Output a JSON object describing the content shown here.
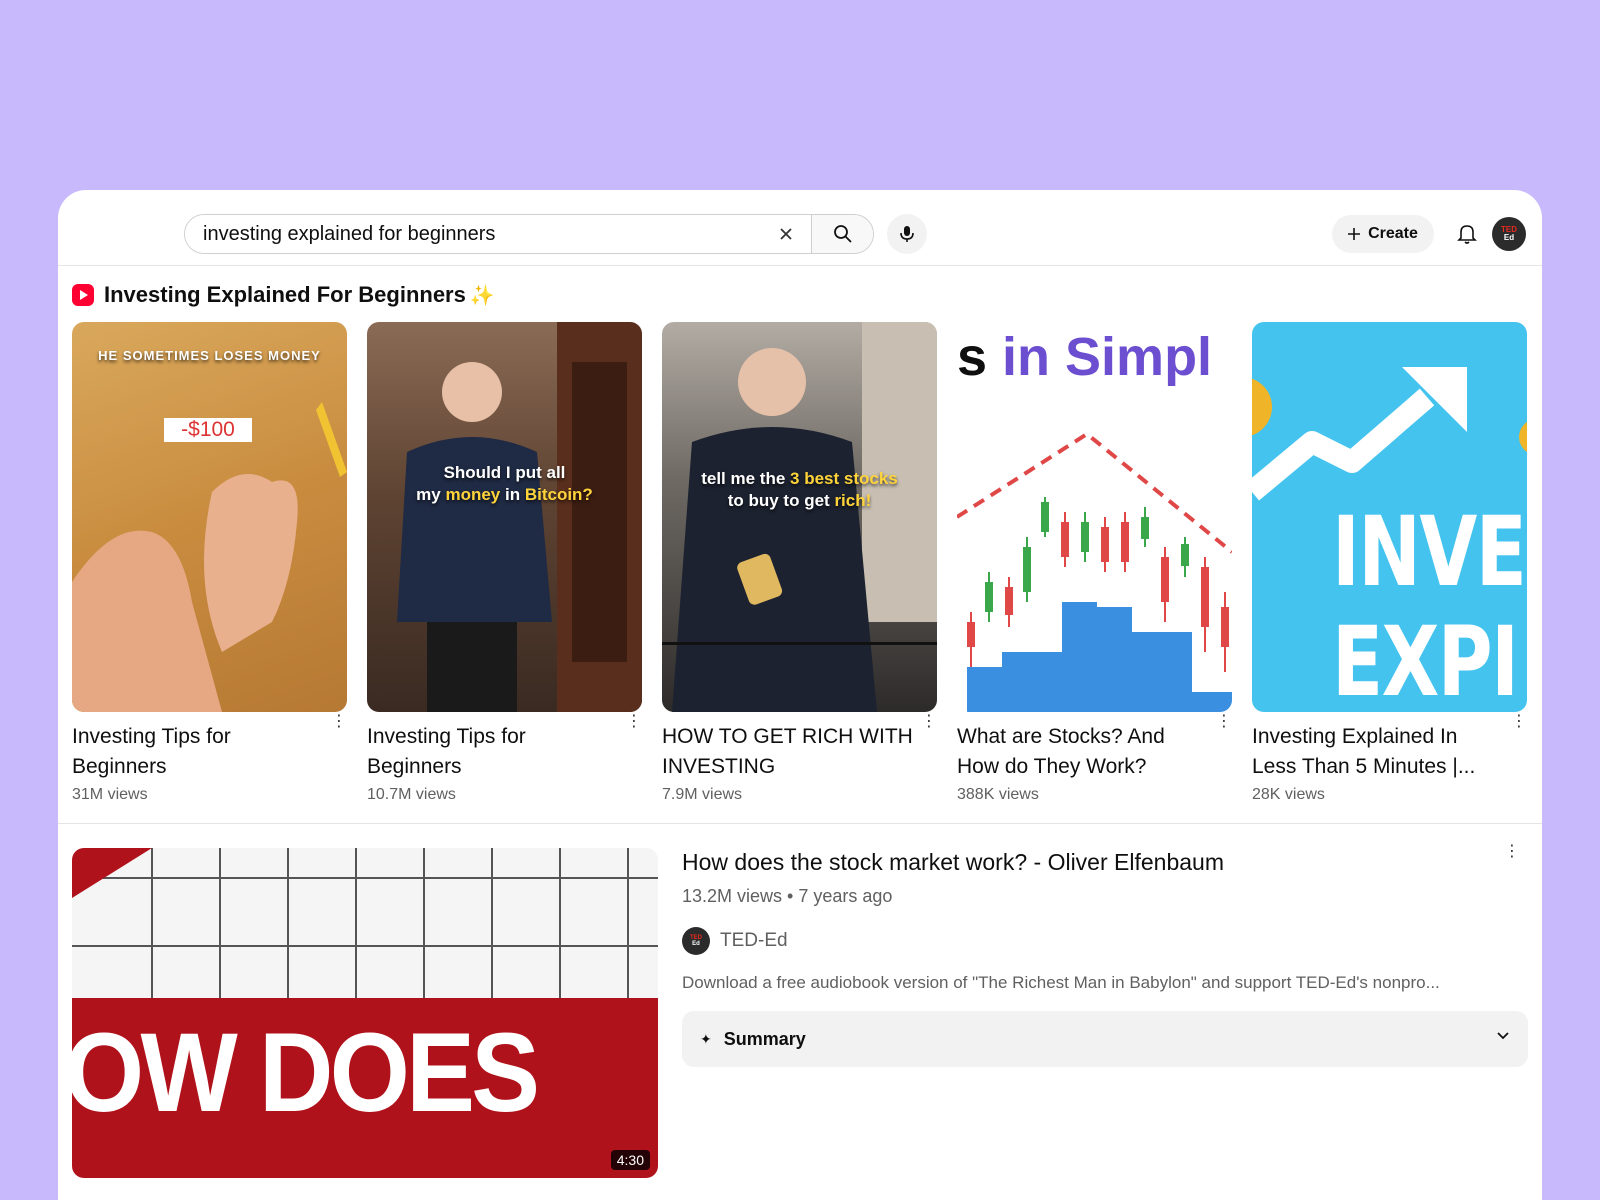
{
  "search": {
    "value": "investing explained for beginners",
    "clear_icon": "close-icon",
    "search_icon": "search-icon"
  },
  "header": {
    "create_label": "Create",
    "avatar_text_top": "TED",
    "avatar_text_bottom": "Ed"
  },
  "shelf": {
    "title": "Investing Explained For Beginners",
    "sparkle": "✨",
    "items": [
      {
        "title": "Investing Tips for Beginners",
        "views": "31M views",
        "thumb_caption": "HE SOMETIMES LOSES MONEY",
        "thumb_label": "-$100"
      },
      {
        "title": "Investing Tips for Beginners",
        "views": "10.7M views",
        "thumb_caption_1": "Should I put all",
        "thumb_caption_2a": "my ",
        "thumb_caption_2b": "money",
        "thumb_caption_2c": " in ",
        "thumb_caption_2d": "Bitcoin?"
      },
      {
        "title": "HOW TO GET RICH WITH INVESTING",
        "views": "7.9M views",
        "thumb_caption_1a": "tell me the ",
        "thumb_caption_1b": "3 best stocks",
        "thumb_caption_2a": "to buy to get ",
        "thumb_caption_2b": "rich!"
      },
      {
        "title": "What are Stocks? And How do They Work?",
        "views": "388K views",
        "thumb_caption_a": "s ",
        "thumb_caption_b": "in Simpl"
      },
      {
        "title": "Investing Explained In Less Than 5 Minutes |...",
        "views": "28K views",
        "thumb_caption_1": "INVE",
        "thumb_caption_2": "EXPI"
      }
    ]
  },
  "featured": {
    "title": "How does the stock market work? - Oliver Elfenbaum",
    "meta": "13.2M views • 7 years ago",
    "channel": "TED-Ed",
    "channel_avatar_top": "TED",
    "channel_avatar_bottom": "Ed",
    "description": "Download a free audiobook version of \"The Richest Man in Babylon\" and support TED-Ed's nonpro...",
    "summary_label": "Summary",
    "duration": "4:30",
    "thumb_text": "OW DOES"
  },
  "colors": {
    "background": "#c8b9fd",
    "accent_red": "#ff0033",
    "ted_red": "#e62b1e",
    "sky_blue": "#44c3ef",
    "purple_text": "#6b4fd0",
    "gold": "#ffd43b"
  }
}
